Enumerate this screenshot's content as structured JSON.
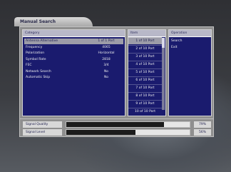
{
  "title": "Manual Search",
  "category": {
    "header": "Category",
    "rows": [
      {
        "label": "Antenna Alternative",
        "value": "1 of 1 Port",
        "selected": true
      },
      {
        "label": "Frequency",
        "value": "4065"
      },
      {
        "label": "Polarization",
        "value": "Horizontal"
      },
      {
        "label": "Symbol Rate",
        "value": "2818"
      },
      {
        "label": "FEC",
        "value": "3/4"
      },
      {
        "label": "Network Search",
        "value": "No"
      },
      {
        "label": "Automatic Skip",
        "value": "No"
      }
    ]
  },
  "tp_list": {
    "header": "Item",
    "items": [
      "1 of 10 Port",
      "2 of 10 Port",
      "3 of 10 Port",
      "4 of 10 Port",
      "5 of 10 Port",
      "6 of 10 Port",
      "7 of 10 Port",
      "8 of 10 Port",
      "9 of 10 Port",
      "10 of 10 Port"
    ],
    "selected_index": 0
  },
  "operation": {
    "header": "Operation",
    "items": [
      "Search",
      "Exit"
    ]
  },
  "signal": {
    "quality": {
      "label": "Signal Quality",
      "percent_text": "79%",
      "level": 0.79
    },
    "level": {
      "label": "Signal Level",
      "percent_text": "56%",
      "level": 0.56
    }
  },
  "colors": {
    "list_bg": "#1a1b6e",
    "selected_bg": "#9c9ca8",
    "panel_bg": "#8f8f8f"
  }
}
